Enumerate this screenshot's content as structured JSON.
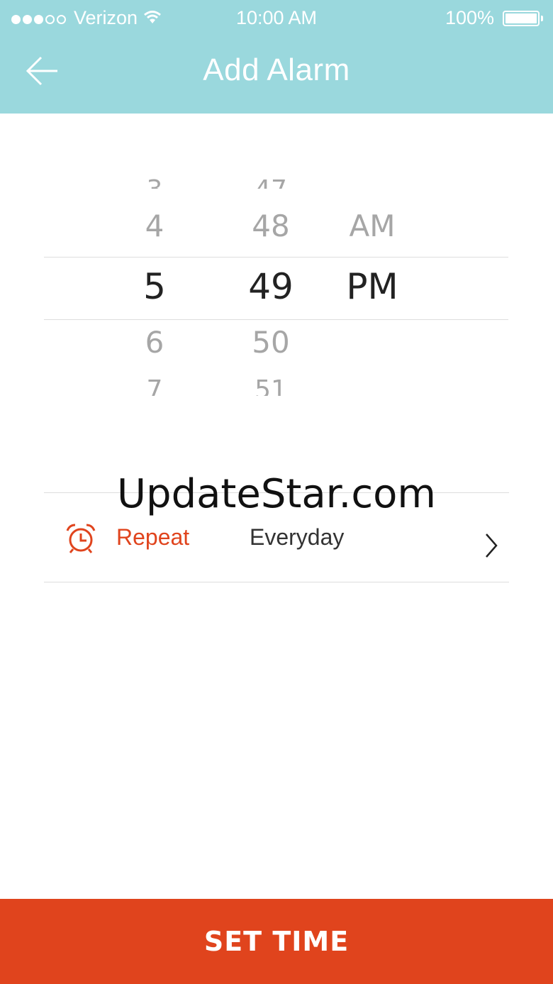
{
  "status_bar": {
    "carrier": "Verizon",
    "signal_bars_filled": 3,
    "signal_bars_total": 5,
    "time": "10:00 AM",
    "battery_percent": "100%",
    "wifi_icon": "wifi-icon",
    "battery_icon": "battery-icon"
  },
  "header": {
    "title": "Add Alarm",
    "back_icon": "arrow-left-icon",
    "background_color": "#9ad8dd"
  },
  "picker": {
    "hours": {
      "far_above": "3",
      "above": "4",
      "selected": "5",
      "below": "6",
      "far_below": "7"
    },
    "minutes": {
      "far_above": "47",
      "above": "48",
      "selected": "49",
      "below": "50",
      "far_below": "51"
    },
    "period": {
      "above": "AM",
      "selected": "PM"
    }
  },
  "watermark": "UpdateStar.com",
  "repeat": {
    "icon": "alarm-clock-icon",
    "label": "Repeat",
    "value": "Everyday",
    "chevron_icon": "chevron-right-icon",
    "accent_color": "#e0441d"
  },
  "set_time_button": {
    "label": "SET TIME",
    "color": "#e0441d"
  }
}
